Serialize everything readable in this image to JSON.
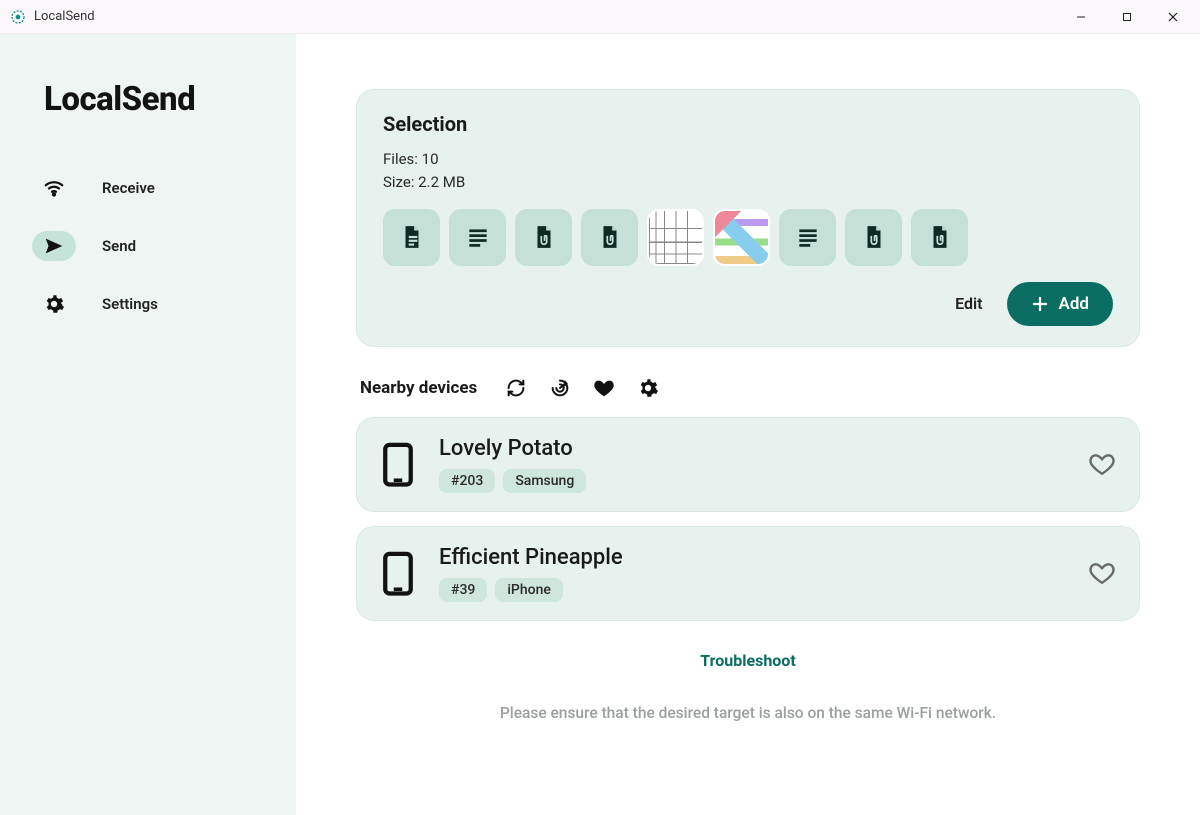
{
  "window": {
    "title": "LocalSend"
  },
  "sidebar": {
    "appTitle": "LocalSend",
    "items": [
      {
        "label": "Receive"
      },
      {
        "label": "Send"
      },
      {
        "label": "Settings"
      }
    ]
  },
  "selection": {
    "title": "Selection",
    "filesLabel": "Files: 10",
    "sizeLabel": "Size: 2.2 MB",
    "editLabel": "Edit",
    "addLabel": "Add",
    "tiles": [
      {
        "kind": "doc"
      },
      {
        "kind": "text"
      },
      {
        "kind": "clip"
      },
      {
        "kind": "clip"
      },
      {
        "kind": "image"
      },
      {
        "kind": "image-color"
      },
      {
        "kind": "text"
      },
      {
        "kind": "clip"
      },
      {
        "kind": "clip"
      }
    ]
  },
  "nearby": {
    "title": "Nearby devices"
  },
  "devices": [
    {
      "name": "Lovely Potato",
      "id": "#203",
      "brand": "Samsung"
    },
    {
      "name": "Efficient Pineapple",
      "id": "#39",
      "brand": "iPhone"
    }
  ],
  "troubleshootLabel": "Troubleshoot",
  "hint": "Please ensure that the desired target is also on the same Wi-Fi network."
}
